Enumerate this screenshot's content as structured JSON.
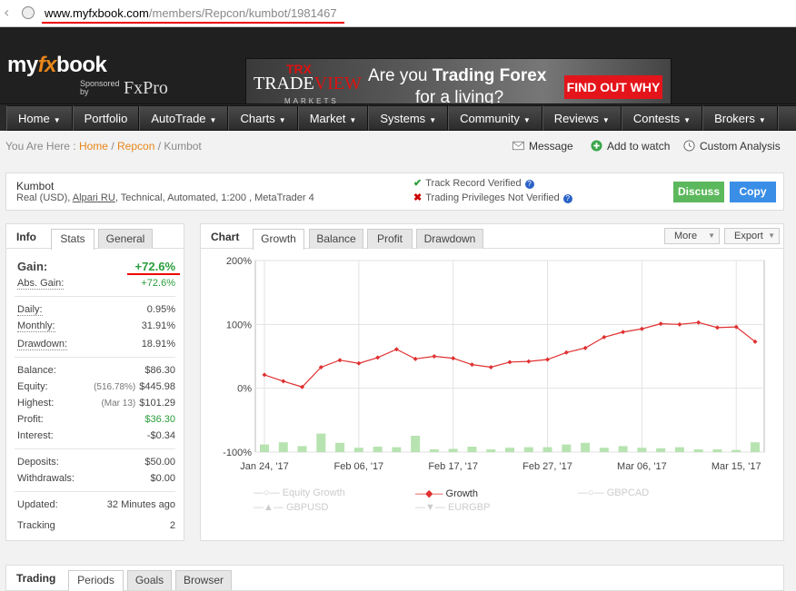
{
  "browser": {
    "url_domain": "www.myfxbook.com",
    "url_path": "/members/Repcon/kumbot/1981467"
  },
  "header": {
    "logo_prefix": "my",
    "logo_fx": "fx",
    "logo_suffix": "book",
    "sponsor_label": "Sponsored by",
    "sponsor_name": "FxPro",
    "banner": {
      "trx": "TRX",
      "brand_a": "TRADE",
      "brand_b": "VIEW",
      "brand_sub": "MARKETS",
      "line1_a": "Are you ",
      "line1_b": "Trading Forex",
      "line2": "for a living?",
      "cta": "FIND OUT WHY"
    }
  },
  "nav": {
    "items": [
      {
        "label": "Home",
        "dropdown": true
      },
      {
        "label": "Portfolio",
        "dropdown": false
      },
      {
        "label": "AutoTrade",
        "dropdown": true
      },
      {
        "label": "Charts",
        "dropdown": true
      },
      {
        "label": "Market",
        "dropdown": true
      },
      {
        "label": "Systems",
        "dropdown": true
      },
      {
        "label": "Community",
        "dropdown": true
      },
      {
        "label": "Reviews",
        "dropdown": true
      },
      {
        "label": "Contests",
        "dropdown": true
      },
      {
        "label": "Brokers",
        "dropdown": true
      }
    ]
  },
  "breadcrumb": {
    "prefix": "You Are Here :",
    "home": "Home",
    "user": "Repcon",
    "current": "Kumbot",
    "sep": "/"
  },
  "actions": {
    "message": "Message",
    "watch": "Add to watch",
    "analysis": "Custom Analysis"
  },
  "account": {
    "name": "Kumbot",
    "desc_a": "Real (USD), ",
    "broker": "Alpari RU",
    "desc_b": ", Technical, Automated, 1:200 , MetaTrader 4",
    "verified_track": "Track Record Verified",
    "verified_priv": "Trading Privileges Not Verified",
    "discuss": "Discuss",
    "copy": "Copy"
  },
  "info": {
    "title": "Info",
    "tabs": [
      "Stats",
      "General"
    ],
    "gain_label": "Gain:",
    "gain_value": "+72.6%",
    "abs_gain_label": "Abs. Gain:",
    "abs_gain_value": "+72.6%",
    "daily_label": "Daily:",
    "daily_value": "0.95%",
    "monthly_label": "Monthly:",
    "monthly_value": "31.91%",
    "drawdown_label": "Drawdown:",
    "drawdown_value": "18.91%",
    "balance_label": "Balance:",
    "balance_value": "$86.30",
    "equity_label": "Equity:",
    "equity_pct": "(516.78%)",
    "equity_value": "$445.98",
    "highest_label": "Highest:",
    "highest_date": "(Mar 13)",
    "highest_value": "$101.29",
    "profit_label": "Profit:",
    "profit_value": "$36.30",
    "interest_label": "Interest:",
    "interest_value": "-$0.34",
    "deposits_label": "Deposits:",
    "deposits_value": "$50.00",
    "withdrawals_label": "Withdrawals:",
    "withdrawals_value": "$0.00",
    "updated_label": "Updated:",
    "updated_value": "32 Minutes ago",
    "tracking_label": "Tracking",
    "tracking_value": "2"
  },
  "chart_panel": {
    "title": "Chart",
    "tabs": [
      "Growth",
      "Balance",
      "Profit",
      "Drawdown"
    ],
    "more": "More",
    "export": "Export",
    "legend": {
      "equity_growth": "Equity Growth",
      "growth": "Growth",
      "gbpcad": "GBPCAD",
      "gbpusd": "GBPUSD",
      "eurgbp": "EURGBP"
    }
  },
  "chart_data": {
    "type": "line",
    "ytick_labels": [
      "200%",
      "100%",
      "0%",
      "-100%"
    ],
    "yticks": [
      200,
      100,
      0,
      -100
    ],
    "ylim": [
      -100,
      200
    ],
    "xtick_labels": [
      "Jan 24, '17",
      "Feb 06, '17",
      "Feb 17, '17",
      "Feb 27, '17",
      "Mar 06, '17",
      "Mar 15, '17"
    ],
    "xtick_index": [
      0,
      5,
      10,
      15,
      20,
      25
    ],
    "series": [
      {
        "name": "Growth",
        "color": "#e03030",
        "values": [
          21,
          11,
          2,
          33,
          44,
          39,
          48,
          61,
          46,
          50,
          47,
          37,
          33,
          41,
          42,
          45,
          56,
          63,
          80,
          88,
          93,
          101,
          100,
          103,
          95,
          96,
          73
        ]
      }
    ],
    "bars": {
      "color": "#b7e3b0",
      "values": [
        14,
        18,
        11,
        34,
        17,
        8,
        10,
        9,
        30,
        5,
        6,
        10,
        5,
        8,
        9,
        9,
        14,
        17,
        8,
        11,
        8,
        7,
        9,
        5,
        5,
        4,
        18
      ]
    },
    "grid": true
  },
  "trading": {
    "title": "Trading",
    "tabs": [
      "Periods",
      "Goals",
      "Browser"
    ]
  }
}
